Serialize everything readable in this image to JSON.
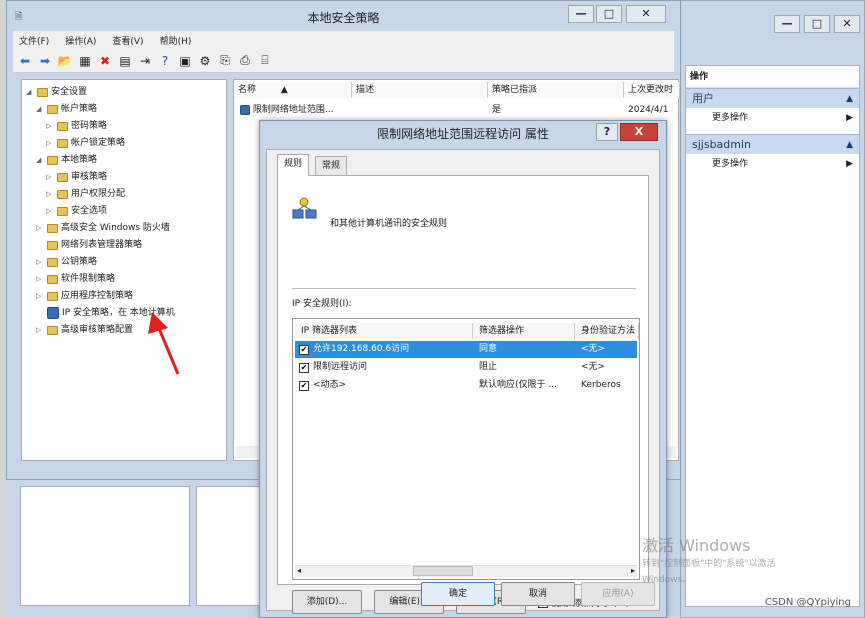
{
  "main_window": {
    "title": "本地安全策略",
    "menu": [
      "文件(F)",
      "操作(A)",
      "查看(V)",
      "帮助(H)"
    ],
    "tree": [
      {
        "label": "安全设置",
        "level": 0,
        "caret": "◢"
      },
      {
        "label": "帐户策略",
        "level": 1,
        "caret": "◢"
      },
      {
        "label": "密码策略",
        "level": 2,
        "caret": "▷"
      },
      {
        "label": "帐户锁定策略",
        "level": 2,
        "caret": "▷"
      },
      {
        "label": "本地策略",
        "level": 1,
        "caret": "◢"
      },
      {
        "label": "审核策略",
        "level": 2,
        "caret": "▷"
      },
      {
        "label": "用户权限分配",
        "level": 2,
        "caret": "▷"
      },
      {
        "label": "安全选项",
        "level": 2,
        "caret": "▷"
      },
      {
        "label": "高级安全 Windows 防火墙",
        "level": 1,
        "caret": "▷"
      },
      {
        "label": "网络列表管理器策略",
        "level": 1,
        "caret": ""
      },
      {
        "label": "公钥策略",
        "level": 1,
        "caret": "▷"
      },
      {
        "label": "软件限制策略",
        "level": 1,
        "caret": "▷"
      },
      {
        "label": "应用程序控制策略",
        "level": 1,
        "caret": "▷"
      },
      {
        "label": "IP 安全策略，在 本地计算机",
        "level": 1,
        "caret": ""
      },
      {
        "label": "高级审核策略配置",
        "level": 1,
        "caret": "▷"
      }
    ],
    "list_headers": [
      "名称",
      "描述",
      "策略已指派",
      "上次更改时"
    ],
    "list_rows": [
      {
        "name": "限制网络地址范围...",
        "desc": "",
        "assigned": "是",
        "changed": "2024/4/1"
      }
    ]
  },
  "actions_panel": {
    "title": "操作",
    "sections": [
      {
        "name": "用户",
        "items": [
          "更多操作"
        ]
      },
      {
        "name": "sjjsbadmin",
        "items": [
          "更多操作"
        ]
      }
    ]
  },
  "dialog": {
    "title": "限制网络地址范围远程访问 属性",
    "help": "?",
    "close": "X",
    "tabs": [
      "规则",
      "常规"
    ],
    "description": "和其他计算机通讯的安全规则",
    "rules_label": "IP 安全规则(I):",
    "rules_headers": [
      "IP 筛选器列表",
      "筛选器操作",
      "身份验证方法"
    ],
    "rules": [
      {
        "filter": "允许192.168.60.6访问",
        "action": "同意",
        "auth": "<无>",
        "checked": true,
        "selected": true
      },
      {
        "filter": "限制远程访问",
        "action": "阻止",
        "auth": "<无>",
        "checked": true,
        "selected": false
      },
      {
        "filter": "<动态>",
        "action": "默认响应(仅限于 ...",
        "auth": "Kerberos",
        "checked": true,
        "selected": false
      }
    ],
    "buttons": {
      "add": "添加(D)...",
      "edit": "编辑(E)...",
      "remove": "删除(R)",
      "wizard": "使用\"添加向导\"(W)",
      "ok": "确定",
      "cancel": "取消",
      "apply": "应用(A)"
    },
    "wizard_checked": true
  },
  "overlays": {
    "activate_title": "激活 Windows",
    "activate_sub": "转到\"控制面板\"中的\"系统\"以激活",
    "activate_sub2": "Windows。",
    "credit": "CSDN @QYpiying"
  },
  "colors": {
    "accent": "#2f8de0",
    "close": "#c7443a",
    "arrow": "#e02020"
  }
}
